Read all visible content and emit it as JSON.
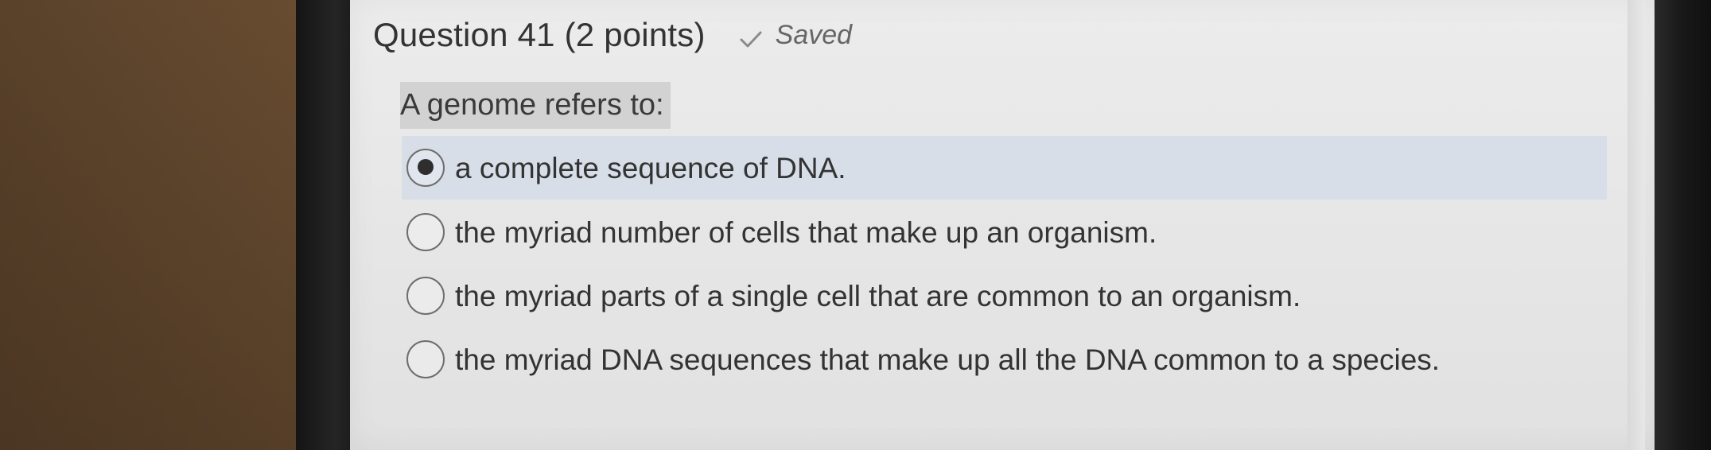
{
  "question": {
    "number_text": "Question 41",
    "points_text": "(2 points)",
    "saved_text": "Saved",
    "prompt": "A genome refers to:",
    "options": [
      {
        "label": "a complete sequence of DNA.",
        "selected": true
      },
      {
        "label": "the myriad number of cells that make up an organism.",
        "selected": false
      },
      {
        "label": "the myriad parts of a single cell that are common to an organism.",
        "selected": false
      },
      {
        "label": "the myriad DNA sequences that make up all the DNA common to a species.",
        "selected": false
      }
    ]
  },
  "colors": {
    "selected_row": "#d7dee8",
    "prompt_highlight": "#d2d2d2",
    "screen_background": "#e7e7e7"
  },
  "icons": {
    "saved_status": "check-icon",
    "answer_selector": "radio-icon"
  }
}
